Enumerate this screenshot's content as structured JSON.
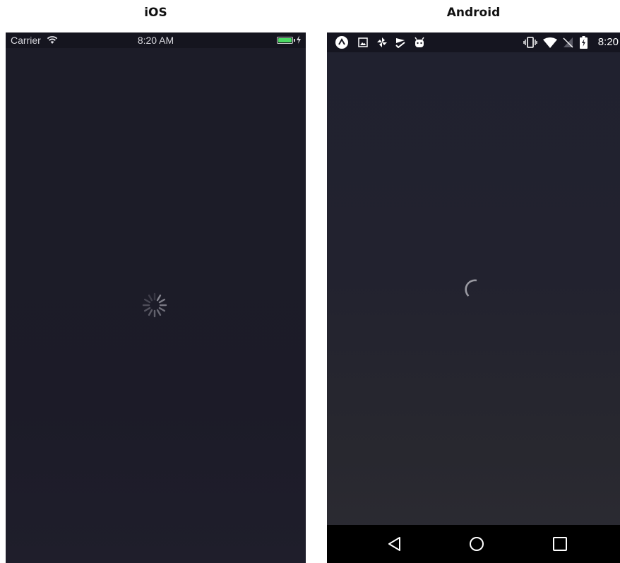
{
  "headings": {
    "ios": "iOS",
    "android": "Android"
  },
  "ios": {
    "status_bar": {
      "carrier": "Carrier",
      "time": "8:20 AM",
      "icons": [
        "wifi-icon",
        "battery-icon",
        "charging-bolt-icon"
      ],
      "battery_color": "#4cd964"
    },
    "content": {
      "indicator": "activity-spinner"
    }
  },
  "android": {
    "status_bar": {
      "time": "8:20",
      "notification_icons": [
        "expo-icon",
        "image-icon",
        "pinwheel-icon",
        "checkmark-flag-icon",
        "android-bug-icon"
      ],
      "system_icons": [
        "vibrate-icon",
        "wifi-icon",
        "no-sim-icon",
        "battery-charging-icon"
      ]
    },
    "content": {
      "indicator": "circular-progress"
    },
    "nav_bar": {
      "buttons": [
        "back-button",
        "home-button",
        "recents-button"
      ]
    }
  }
}
